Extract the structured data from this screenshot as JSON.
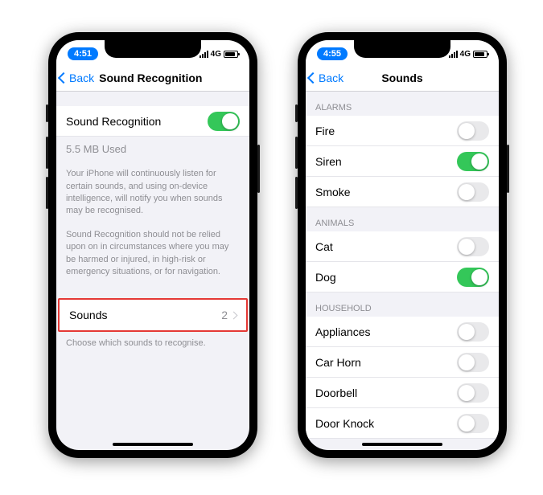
{
  "phone1": {
    "time": "4:51",
    "network": "4G",
    "back": "Back",
    "title": "Sound Recognition",
    "toggleRow": {
      "label": "Sound Recognition",
      "on": true
    },
    "usage": "5.5 MB Used",
    "desc1": "Your iPhone will continuously listen for certain sounds, and using on-device intelligence, will notify you when sounds may be recognised.",
    "desc2": "Sound Recognition should not be relied upon on in circumstances where you may be harmed or injured, in high-risk or emergency situations, or for navigation.",
    "soundsRow": {
      "label": "Sounds",
      "value": "2"
    },
    "soundsFooter": "Choose which sounds to recognise."
  },
  "phone2": {
    "time": "4:55",
    "network": "4G",
    "back": "Back",
    "title": "Sounds",
    "sections": {
      "alarms": {
        "header": "ALARMS",
        "items": [
          {
            "label": "Fire",
            "on": false
          },
          {
            "label": "Siren",
            "on": true
          },
          {
            "label": "Smoke",
            "on": false
          }
        ]
      },
      "animals": {
        "header": "ANIMALS",
        "items": [
          {
            "label": "Cat",
            "on": false
          },
          {
            "label": "Dog",
            "on": true
          }
        ]
      },
      "household": {
        "header": "HOUSEHOLD",
        "items": [
          {
            "label": "Appliances",
            "on": false
          },
          {
            "label": "Car Horn",
            "on": false
          },
          {
            "label": "Doorbell",
            "on": false
          },
          {
            "label": "Door Knock",
            "on": false
          }
        ]
      }
    }
  }
}
